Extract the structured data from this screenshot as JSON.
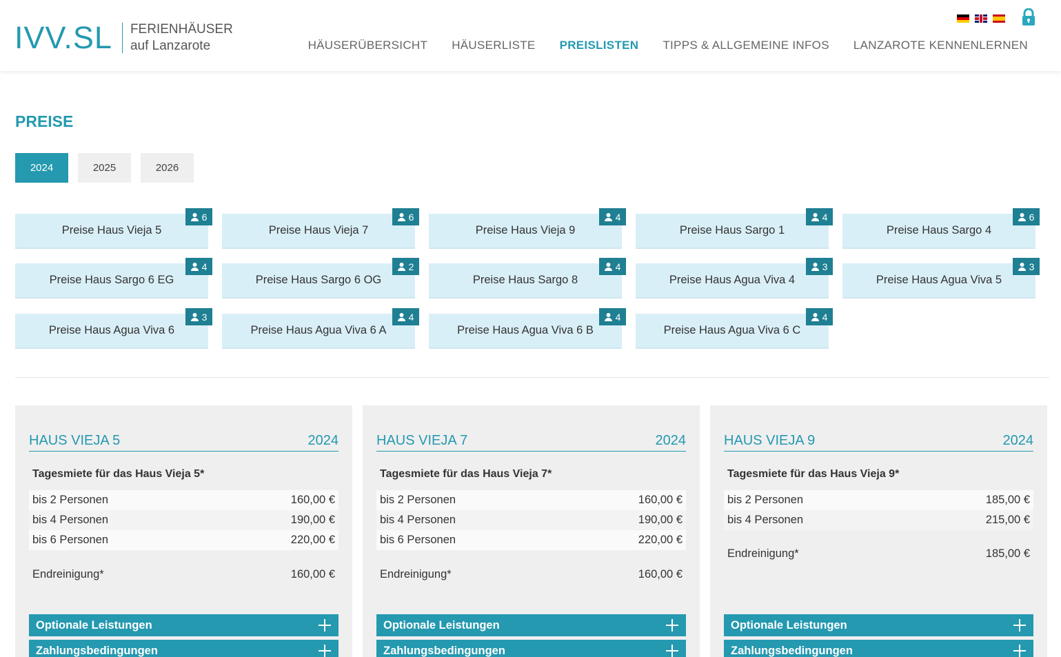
{
  "header": {
    "logo_mark": "IVV.SL",
    "logo_line1": "FERIENHÄUSER",
    "logo_line2": "auf Lanzarote",
    "nav": [
      {
        "label": "HÄUSERÜBERSICHT",
        "active": false
      },
      {
        "label": "HÄUSERLISTE",
        "active": false
      },
      {
        "label": "PREISLISTEN",
        "active": true
      },
      {
        "label": "TIPPS & ALLGEMEINE INFOS",
        "active": false
      },
      {
        "label": "LANZAROTE KENNENLERNEN",
        "active": false
      }
    ],
    "languages": [
      "de-flag-icon",
      "en-flag-icon",
      "es-flag-icon"
    ]
  },
  "page": {
    "title": "PREISE",
    "years": [
      {
        "label": "2024",
        "active": true
      },
      {
        "label": "2025",
        "active": false
      },
      {
        "label": "2026",
        "active": false
      }
    ]
  },
  "houses": [
    {
      "label": "Preise Haus Vieja 5",
      "persons": "6"
    },
    {
      "label": "Preise Haus Vieja 7",
      "persons": "6"
    },
    {
      "label": "Preise Haus Vieja 9",
      "persons": "4"
    },
    {
      "label": "Preise Haus Sargo 1",
      "persons": "4"
    },
    {
      "label": "Preise Haus Sargo 4",
      "persons": "6"
    },
    {
      "label": "Preise Haus Sargo 6 EG",
      "persons": "4"
    },
    {
      "label": "Preise Haus Sargo 6 OG",
      "persons": "2"
    },
    {
      "label": "Preise Haus Sargo 8",
      "persons": "4"
    },
    {
      "label": "Preise Haus Agua Viva 4",
      "persons": "3"
    },
    {
      "label": "Preise Haus Agua Viva 5",
      "persons": "3"
    },
    {
      "label": "Preise Haus Agua Viva 6",
      "persons": "3"
    },
    {
      "label": "Preise Haus Agua Viva 6 A",
      "persons": "4"
    },
    {
      "label": "Preise Haus Agua Viva 6 B",
      "persons": "4"
    },
    {
      "label": "Preise Haus Agua Viva 6 C",
      "persons": "4"
    }
  ],
  "cards": [
    {
      "name": "HAUS VIEJA 5",
      "year": "2024",
      "subtitle": "Tagesmiete für das Haus Vieja 5*",
      "rows": [
        {
          "label": "bis 2 Personen",
          "price": "160,00 €"
        },
        {
          "label": "bis 4 Personen",
          "price": "190,00 €"
        },
        {
          "label": "bis 6 Personen",
          "price": "220,00 €"
        }
      ],
      "cleaning_label": "Endreinigung*",
      "cleaning_price": "160,00 €",
      "optional_label": "Optionale Leistungen",
      "payment_label": "Zahlungsbedingungen"
    },
    {
      "name": "HAUS VIEJA 7",
      "year": "2024",
      "subtitle": "Tagesmiete für das Haus Vieja 7*",
      "rows": [
        {
          "label": "bis 2 Personen",
          "price": "160,00 €"
        },
        {
          "label": "bis 4 Personen",
          "price": "190,00 €"
        },
        {
          "label": "bis 6 Personen",
          "price": "220,00 €"
        }
      ],
      "cleaning_label": "Endreinigung*",
      "cleaning_price": "160,00 €",
      "optional_label": "Optionale Leistungen",
      "payment_label": "Zahlungsbedingungen"
    },
    {
      "name": "HAUS VIEJA 9",
      "year": "2024",
      "subtitle": "Tagesmiete für das Haus Vieja 9*",
      "rows": [
        {
          "label": "bis 2 Personen",
          "price": "185,00 €"
        },
        {
          "label": "bis 4 Personen",
          "price": "215,00 €"
        }
      ],
      "cleaning_label": "Endreinigung*",
      "cleaning_price": "185,00 €",
      "optional_label": "Optionale Leistungen",
      "payment_label": "Zahlungsbedingungen"
    }
  ],
  "colors": {
    "accent": "#2499b0",
    "badge": "#1f7f93",
    "tile": "#d9eff7",
    "card": "#efefef"
  }
}
